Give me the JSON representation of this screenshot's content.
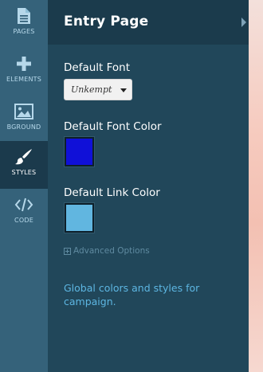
{
  "sidebar": {
    "items": [
      {
        "label": "PAGES",
        "icon": "document-icon"
      },
      {
        "label": "ELEMENTS",
        "icon": "plus-icon"
      },
      {
        "label": "BGROUND",
        "icon": "image-icon"
      },
      {
        "label": "STYLES",
        "icon": "paintbrush-icon",
        "active": true
      },
      {
        "label": "CODE",
        "icon": "code-icon"
      }
    ]
  },
  "panel": {
    "title": "Entry Page",
    "default_font": {
      "label": "Default Font",
      "value": "Unkempt"
    },
    "default_font_color": {
      "label": "Default Font Color",
      "color": "#1010d8"
    },
    "default_link_color": {
      "label": "Default Link Color",
      "color": "#61b6e0"
    },
    "advanced_options": "Advanced Options",
    "help_text": "Global colors and styles for campaign."
  },
  "colors": {
    "sidebar_bg": "#35627a",
    "sidebar_active_bg": "#1b3a4c",
    "panel_bg": "#21475a",
    "header_bg": "#1b3b4c",
    "help_text": "#5db6e2"
  }
}
